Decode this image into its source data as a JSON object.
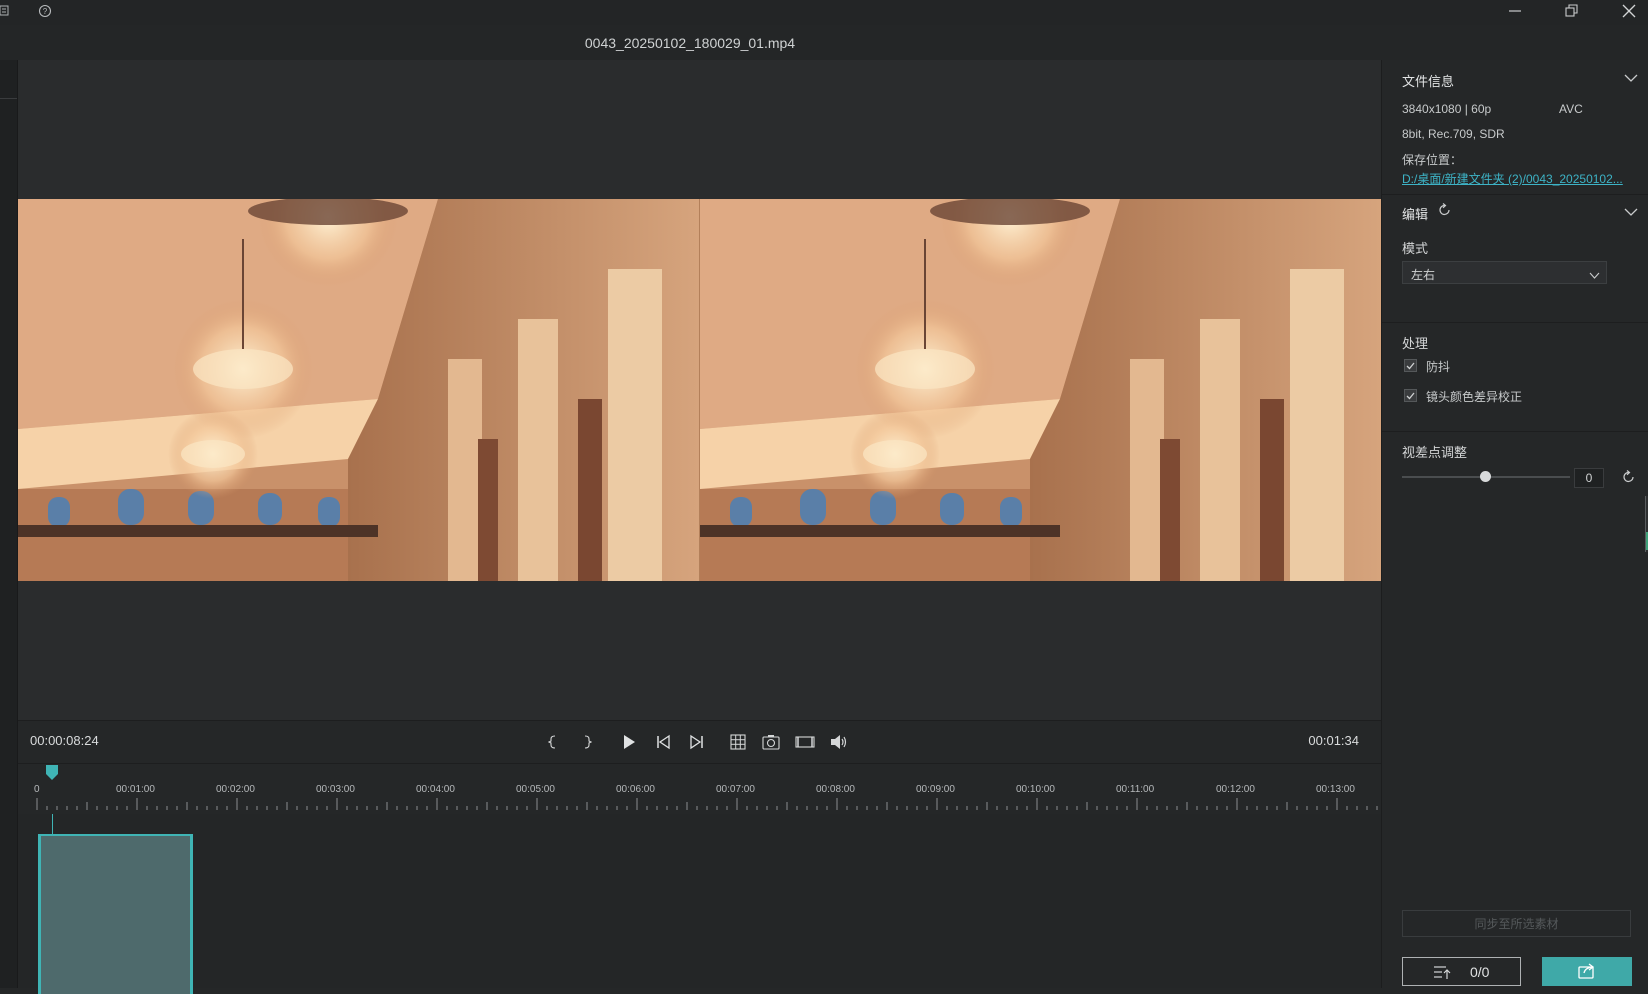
{
  "file": {
    "title": "0043_20250102_180029_01.mp4"
  },
  "player": {
    "current_time": "00:00:08:24",
    "duration": "00:01:34"
  },
  "timeline": {
    "ticks": [
      "0",
      "00:01:00",
      "00:02:00",
      "00:03:00",
      "00:04:00",
      "00:05:00",
      "00:06:00",
      "00:07:00",
      "00:08:00",
      "00:09:00",
      "00:10:00",
      "00:11:00",
      "00:12:00",
      "00:13:00"
    ]
  },
  "panel": {
    "file_info": {
      "title": "文件信息",
      "resolution": "3840x1080 | 60p",
      "codec": "AVC",
      "color": "8bit, Rec.709, SDR",
      "save_label": "保存位置：",
      "save_path": "D:/桌面/新建文件夹 (2)/0043_20250102..."
    },
    "edit": {
      "title": "编辑",
      "mode_label": "模式",
      "mode_value": "左右",
      "process_label": "处理",
      "stabilize_label": "防抖",
      "color_correct_label": "镜头颜色差异校正",
      "parallax_label": "视差点调整",
      "parallax_value": "0"
    },
    "sync_button": "同步至所选素材",
    "export_count": "0/0"
  },
  "colors": {
    "accent": "#3fb4b5",
    "link": "#3db3c6",
    "bg": "#252728"
  }
}
